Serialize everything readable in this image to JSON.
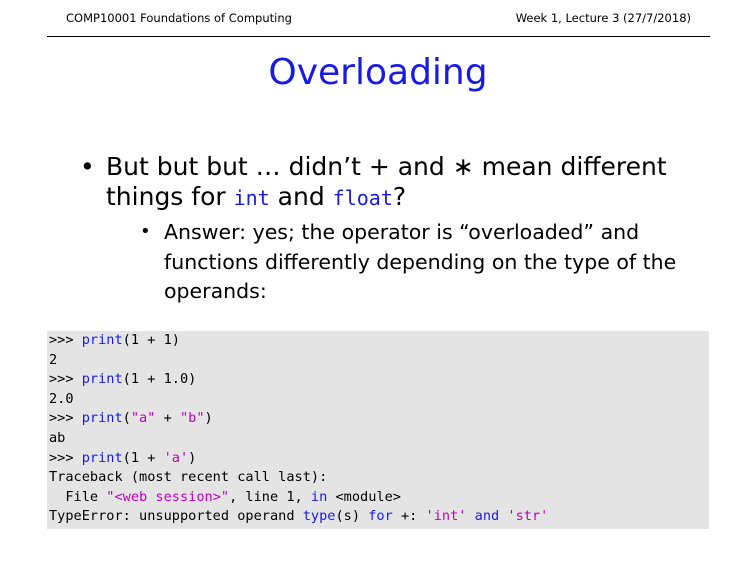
{
  "header": {
    "course": "COMP10001 Foundations of Computing",
    "lecture": "Week 1, Lecture 3 (27/7/2018)"
  },
  "slide": {
    "title": "Overloading",
    "bullet1": {
      "prefix": "But but but … didn’t + and ∗ mean different things for ",
      "code1": "int",
      "middle": " and ",
      "code2": "float",
      "suffix": "?"
    },
    "bullet2": {
      "text": "Answer: yes; the operator is “overloaded” and functions differently depending on the type of the operands:"
    }
  },
  "code": {
    "lines": [
      [
        {
          "t": ">>> "
        },
        {
          "t": "print",
          "c": "kw"
        },
        {
          "t": "(1 + 1)"
        }
      ],
      [
        {
          "t": "2"
        }
      ],
      [
        {
          "t": ">>> "
        },
        {
          "t": "print",
          "c": "kw"
        },
        {
          "t": "(1 + 1.0)"
        }
      ],
      [
        {
          "t": "2.0"
        }
      ],
      [
        {
          "t": ">>> "
        },
        {
          "t": "print",
          "c": "kw"
        },
        {
          "t": "("
        },
        {
          "t": "\"a\"",
          "c": "str"
        },
        {
          "t": " + "
        },
        {
          "t": "\"b\"",
          "c": "str"
        },
        {
          "t": ")"
        }
      ],
      [
        {
          "t": "ab"
        }
      ],
      [
        {
          "t": ">>> "
        },
        {
          "t": "print",
          "c": "kw"
        },
        {
          "t": "(1 + "
        },
        {
          "t": "'a'",
          "c": "str"
        },
        {
          "t": ")"
        }
      ],
      [
        {
          "t": "Traceback (most recent call last):"
        }
      ],
      [
        {
          "t": "  File "
        },
        {
          "t": "\"<web session>\"",
          "c": "str"
        },
        {
          "t": ", line 1, "
        },
        {
          "t": "in",
          "c": "kw"
        },
        {
          "t": " <module>"
        }
      ],
      [
        {
          "t": "TypeError: unsupported operand "
        },
        {
          "t": "type",
          "c": "kw"
        },
        {
          "t": "(s) "
        },
        {
          "t": "for",
          "c": "kw"
        },
        {
          "t": " +: "
        },
        {
          "t": "'int'",
          "c": "str"
        },
        {
          "t": " "
        },
        {
          "t": "and",
          "c": "kw"
        },
        {
          "t": " "
        },
        {
          "t": "'str'",
          "c": "str"
        }
      ]
    ]
  }
}
